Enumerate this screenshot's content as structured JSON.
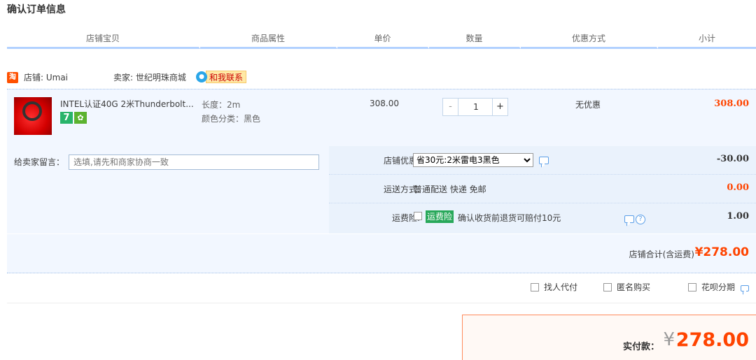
{
  "page": {
    "title": "确认订单信息"
  },
  "columns": [
    "店铺宝贝",
    "商品属性",
    "单价",
    "数量",
    "优惠方式",
    "小计"
  ],
  "shop": {
    "icon_text": "淘",
    "shop_label": "店铺: Umai",
    "seller_label": "卖家: 世纪明珠商城",
    "contact_label": "和我联系"
  },
  "item": {
    "title": "INTEL认证40G 2米Thunderbolt...",
    "badge_seven": "7",
    "attr_length": "长度：2m",
    "attr_color": "颜色分类：黑色",
    "unit_price": "308.00",
    "quantity": "1",
    "minus": "-",
    "plus": "+",
    "discount": "无优惠",
    "subtotal": "308.00"
  },
  "message": {
    "label": "给卖家留言：",
    "placeholder": "选填,请先和商家协商一致"
  },
  "options": {
    "coupon_label": "店铺优惠:",
    "coupon_selected": "省30元:2米雷电3黑色",
    "coupon_amount": "-30.00",
    "shipping_label": "运送方式:",
    "shipping_value": "普通配送 快递 免邮",
    "shipping_amount": "0.00",
    "insurance_label": "运费险:",
    "insurance_badge": "运费险",
    "insurance_text": "确认收货前退货可赔付10元",
    "insurance_amount": "1.00"
  },
  "shop_total": {
    "label": "店铺合计(含运费)",
    "amount": "¥278.00"
  },
  "extras": {
    "proxy_pay": "找人代付",
    "anonymous": "匿名购买",
    "huabei": "花呗分期"
  },
  "payment": {
    "label": "实付款：",
    "currency": "¥",
    "amount": "278.00"
  },
  "colors": {
    "accent": "#ff4400",
    "header_line": "#b2d1ff",
    "block_bg": "#f2f7ff"
  }
}
